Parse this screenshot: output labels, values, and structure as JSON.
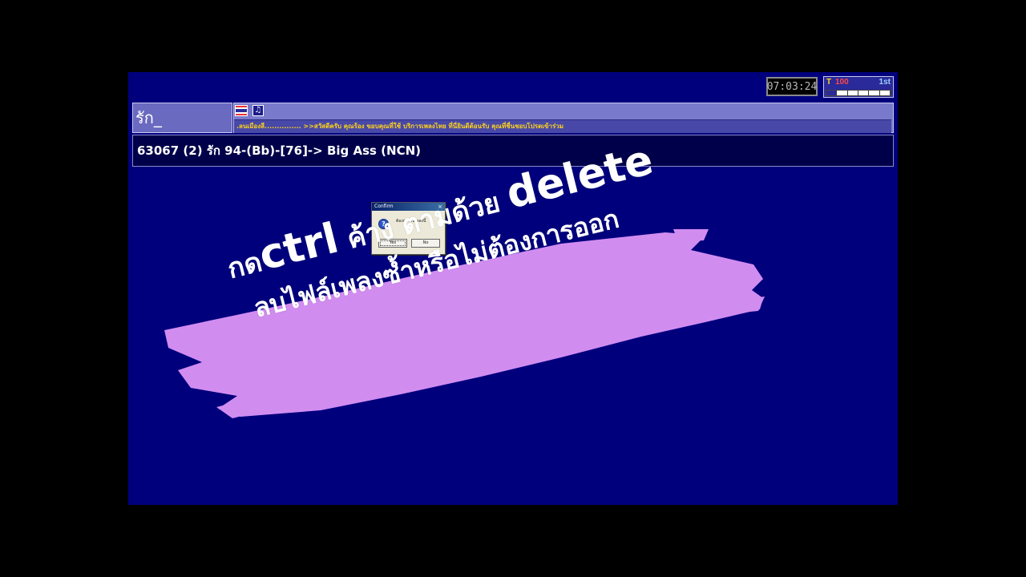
{
  "clock": {
    "time": "07:03:24"
  },
  "tempo": {
    "t_label": "T",
    "value": "100",
    "key": "1st"
  },
  "search": {
    "text": "รัก_"
  },
  "info_panel": {
    "flag_icon": "thai-flag-icon",
    "music_icon": "music-note-icon",
    "marquee": ".ลนเมืองลื............... >>สวัสดีครับ คุณร้อง ขอบคุณที่ใช้ บริการเพลงไทย ที่นี่ยินดีต้อนรับ คุณที่ชื่นชอบโปรดเข้าร่วม"
  },
  "song": {
    "text": "63067 (2) รัก 94-(Bb)-[76]-> Big Ass (NCN)"
  },
  "dialog": {
    "title": "Confirm",
    "close": "×",
    "icon": "question-icon",
    "message": "ต้องการลบเพลงนี้",
    "yes_label": "Yes",
    "no_label": "No"
  },
  "overlay": {
    "line1_a": "กด",
    "line1_ctrl": "ctrl",
    "line1_b": " ค้าง  ตามด้วย ",
    "line1_delete": "delete",
    "line2": "ลบไฟล์เพลงซ้ำหรือไม่ต้องการออก",
    "brush_color": "#d18cf0"
  },
  "colors": {
    "screen_bg": "#00007d",
    "outer_bg": "#000000"
  }
}
